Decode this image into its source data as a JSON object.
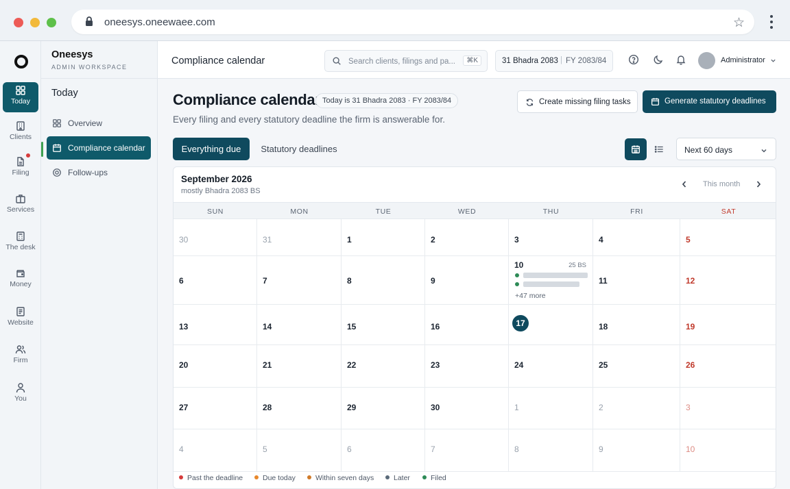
{
  "browser": {
    "url": "oneesys.oneewaee.com",
    "icons": [
      "lock-icon",
      "star-icon",
      "kebab-menu-icon"
    ]
  },
  "rail": {
    "items": [
      {
        "label": "Today",
        "icon": "grid-icon",
        "active": true
      },
      {
        "label": "Clients",
        "icon": "building-icon"
      },
      {
        "label": "Filing",
        "icon": "document-icon",
        "badge": true
      },
      {
        "label": "Services",
        "icon": "briefcase-icon"
      },
      {
        "label": "The desk",
        "icon": "calculator-icon"
      },
      {
        "label": "Money",
        "icon": "wallet-icon"
      },
      {
        "label": "Website",
        "icon": "page-icon"
      },
      {
        "label": "Firm",
        "icon": "people-icon"
      },
      {
        "label": "You",
        "icon": "person-icon"
      }
    ]
  },
  "sidebar": {
    "brand": "Oneesys",
    "workspace": "ADMIN WORKSPACE",
    "section": "Today",
    "items": [
      {
        "label": "Overview",
        "icon": "grid-icon"
      },
      {
        "label": "Compliance calendar",
        "icon": "calendar-icon",
        "active": true
      },
      {
        "label": "Follow-ups",
        "icon": "target-icon"
      }
    ]
  },
  "header": {
    "title": "Compliance calendar",
    "search_placeholder": "Search clients, filings and pa...",
    "search_shortcut": "⌘K",
    "date": "31 Bhadra 2083",
    "fy": "FY 2083/84",
    "user": "Administrator"
  },
  "main": {
    "title": "Compliance calendar",
    "today_pill": "Today is 31 Bhadra 2083 · FY 2083/84",
    "subtitle": "Every filing and every statutory deadline the firm is answerable for.",
    "btn_create": "Create missing filing tasks",
    "btn_generate": "Generate statutory deadlines",
    "tabs": [
      "Everything due",
      "Statutory deadlines"
    ],
    "range": "Next 60 days"
  },
  "calendar": {
    "month": "September 2026",
    "bs_note": "mostly Bhadra 2083 BS",
    "this_month": "This month",
    "weekdays": [
      "SUN",
      "MON",
      "TUE",
      "WED",
      "THU",
      "FRI",
      "SAT"
    ],
    "weeks": [
      [
        "30",
        "31",
        "1",
        "2",
        "3",
        "4",
        "5"
      ],
      [
        "6",
        "7",
        "8",
        "9",
        "10",
        "11",
        "12"
      ],
      [
        "13",
        "14",
        "15",
        "16",
        "17",
        "18",
        "19"
      ],
      [
        "20",
        "21",
        "22",
        "23",
        "24",
        "25",
        "26"
      ],
      [
        "27",
        "28",
        "29",
        "30",
        "1",
        "2",
        "3"
      ],
      [
        "4",
        "5",
        "6",
        "7",
        "8",
        "9",
        "10"
      ]
    ],
    "today": "17",
    "event_day": {
      "bs_date": "25 BS",
      "more": "+47 more"
    }
  },
  "legend": {
    "items": [
      {
        "label": "Past the deadline",
        "color": "#d63c3c"
      },
      {
        "label": "Due today",
        "color": "#e8882c"
      },
      {
        "label": "Within seven days",
        "color": "#d07a2a"
      },
      {
        "label": "Later",
        "color": "#5b6b7a"
      },
      {
        "label": "Filed",
        "color": "#2e8b57"
      }
    ]
  },
  "colors": {
    "accent": "#0f4a5e",
    "weekend": "#c0392b"
  }
}
